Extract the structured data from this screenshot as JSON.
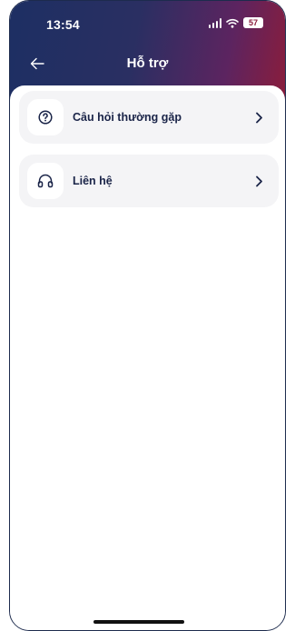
{
  "status_bar": {
    "time": "13:54",
    "battery": "57"
  },
  "header": {
    "title": "Hỗ trợ",
    "gradient_colors": [
      "#1d2f63",
      "#5c2460",
      "#8a1d3c"
    ]
  },
  "menu": {
    "items": [
      {
        "label": "Câu hỏi thường gặp",
        "icon": "question-circle-icon"
      },
      {
        "label": "Liên hệ",
        "icon": "headset-icon"
      }
    ]
  },
  "colors": {
    "text_dark": "#1a2448",
    "item_bg": "#f4f4f6"
  }
}
